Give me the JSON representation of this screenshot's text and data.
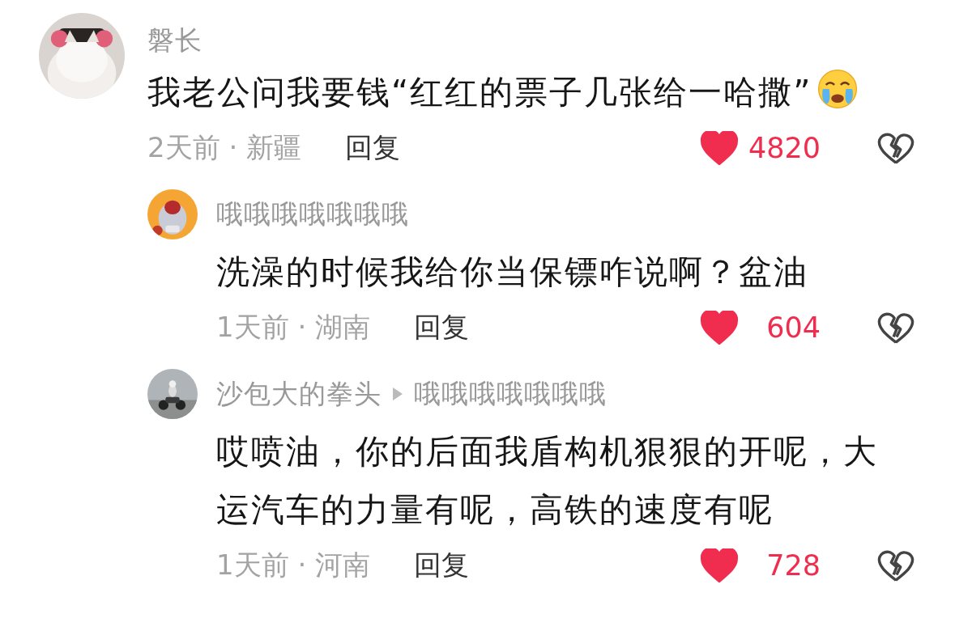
{
  "comments": [
    {
      "author": "磐长",
      "text": "我老公问我要钱“红红的票子几张给一哈撒”",
      "emoji": true,
      "meta": "2天前 · 新疆",
      "reply_label": "回复",
      "likes": "4820",
      "liked": true,
      "replies": [
        {
          "author": "哦哦哦哦哦哦哦",
          "text": "洗澡的时候我给你当保镖咋说啊？盆油",
          "meta": "1天前 · 湖南",
          "reply_label": "回复",
          "likes": "604",
          "liked": true
        },
        {
          "author": "沙包大的拳头",
          "reply_to": "哦哦哦哦哦哦哦",
          "text": "哎喷油，你的后面我盾构机狠狠的开呢，大运汽车的力量有呢，高铁的速度有呢",
          "meta": "1天前 · 河南",
          "reply_label": "回复",
          "likes": "728",
          "liked": true
        }
      ]
    }
  ]
}
